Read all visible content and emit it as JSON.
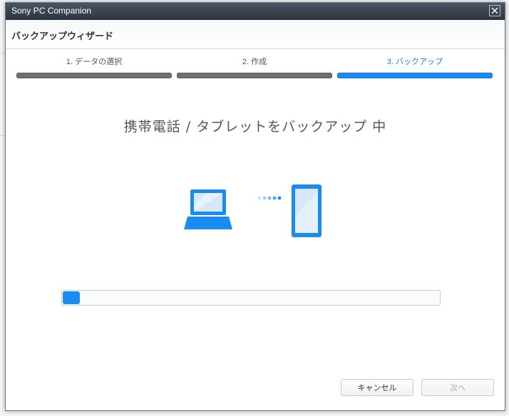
{
  "window": {
    "title": "Sony PC Companion"
  },
  "wizard": {
    "title": "バックアップウィザード"
  },
  "steps": [
    {
      "label": "1. データの選択",
      "state": "done"
    },
    {
      "label": "2. 作成",
      "state": "done"
    },
    {
      "label": "3. バックアップ",
      "state": "active"
    }
  ],
  "status": {
    "text": "携帯電話 / タブレットをバックアップ 中"
  },
  "progress": {
    "fraction": 0.045
  },
  "buttons": {
    "cancel": "キャンセル",
    "next": "次へ"
  },
  "colors": {
    "accent": "#1a8cf0",
    "step_done": "#6f6f6f"
  },
  "icons": [
    "close-icon",
    "laptop-icon",
    "transfer-dots-icon",
    "phone-icon"
  ]
}
